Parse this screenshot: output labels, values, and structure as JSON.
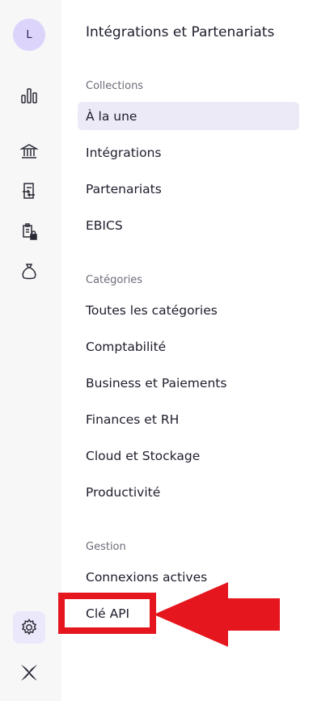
{
  "sidebar_rail": {
    "avatar_initial": "L",
    "icons": [
      "bar-chart-icon",
      "bank-icon",
      "transfer-document-icon",
      "locked-clipboard-icon",
      "money-bag-icon",
      "gear-icon",
      "brand-logo-icon"
    ]
  },
  "panel": {
    "title": "Intégrations et Partenariats",
    "sections": [
      {
        "label": "Collections",
        "items": [
          {
            "label": "À la une",
            "active": true
          },
          {
            "label": "Intégrations"
          },
          {
            "label": "Partenariats"
          },
          {
            "label": "EBICS"
          }
        ]
      },
      {
        "label": "Catégories",
        "items": [
          {
            "label": "Toutes les catégories"
          },
          {
            "label": "Comptabilité"
          },
          {
            "label": "Business et Paiements"
          },
          {
            "label": "Finances et RH"
          },
          {
            "label": "Cloud et Stockage"
          },
          {
            "label": "Productivité"
          }
        ]
      },
      {
        "label": "Gestion",
        "items": [
          {
            "label": "Connexions actives"
          },
          {
            "label": "Clé API",
            "highlighted": true
          }
        ]
      }
    ]
  },
  "colors": {
    "accent_bg": "#edeaf8",
    "avatar_bg": "#dcd4fb",
    "annotation_red": "#e5161d"
  }
}
